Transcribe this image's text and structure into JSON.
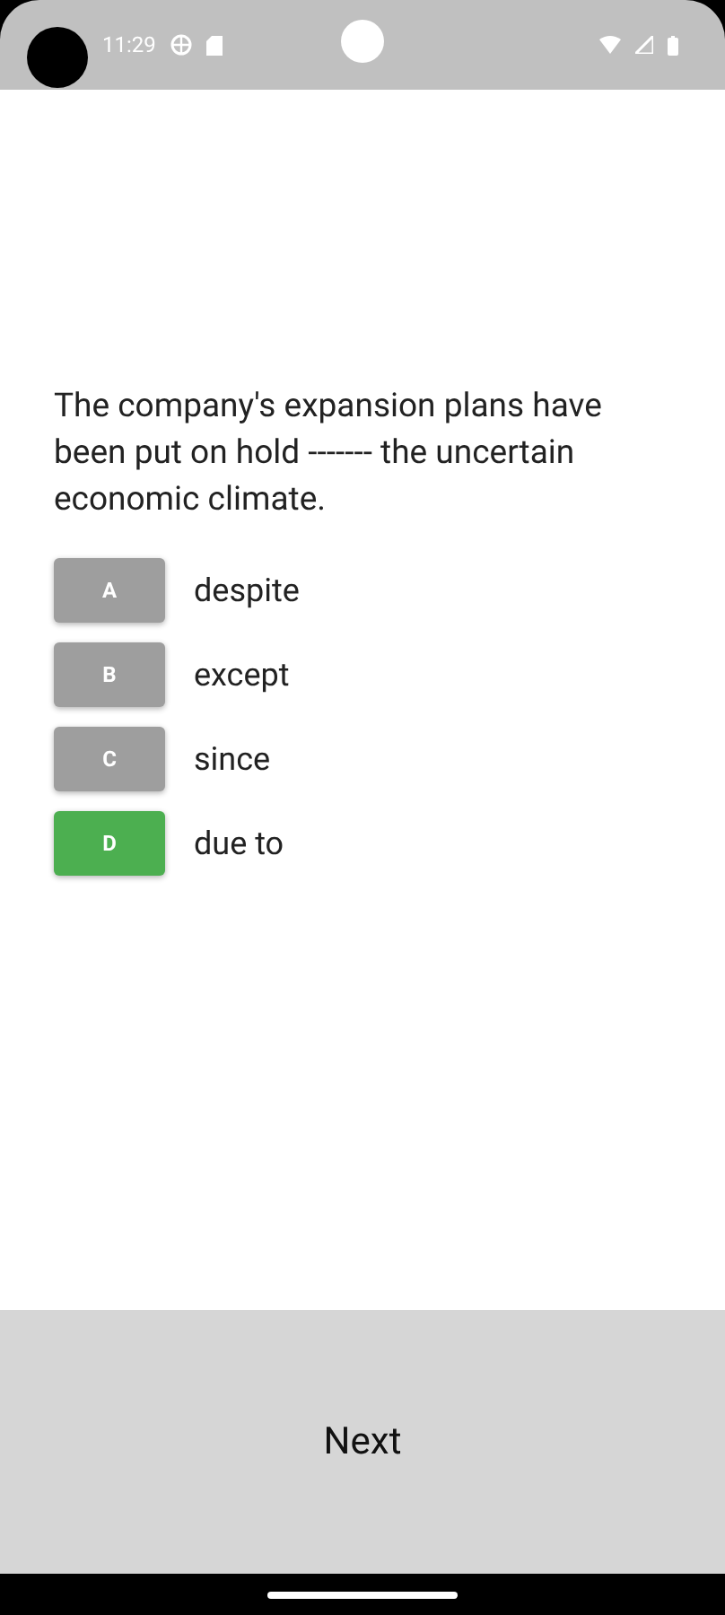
{
  "status_bar": {
    "time": "11:29"
  },
  "question": "The company's expansion plans have been put on hold ------- the uncertain economic climate.",
  "options": [
    {
      "letter": "A",
      "text": "despite",
      "selected": false
    },
    {
      "letter": "B",
      "text": "except",
      "selected": false
    },
    {
      "letter": "C",
      "text": "since",
      "selected": false
    },
    {
      "letter": "D",
      "text": "due to",
      "selected": true
    }
  ],
  "next_button": "Next"
}
